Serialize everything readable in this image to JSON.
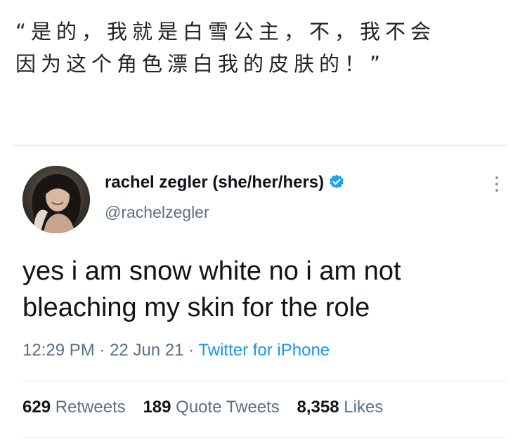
{
  "caption": {
    "line1": "“是的，我就是白雪公主，不，我不会",
    "line2": "因为这个角色漂白我的皮肤的！”"
  },
  "tweet": {
    "display_name": "rachel zegler (she/her/hers)",
    "handle": "@rachelzegler",
    "verified_icon": "verified-badge-icon",
    "text_line1": "yes i am snow white no i am not",
    "text_line2": "bleaching my skin for the role",
    "time": "12:29 PM",
    "date": "22 Jun 21",
    "separator": "·",
    "source": "Twitter for iPhone",
    "stats": {
      "retweets_count": "629",
      "retweets_label": "Retweets",
      "quote_tweets_count": "189",
      "quote_tweets_label": "Quote Tweets",
      "likes_count": "8,358",
      "likes_label": "Likes"
    }
  },
  "colors": {
    "link_blue": "#1b95e0",
    "secondary_text": "#5b7083",
    "primary_text": "#0f1419"
  }
}
